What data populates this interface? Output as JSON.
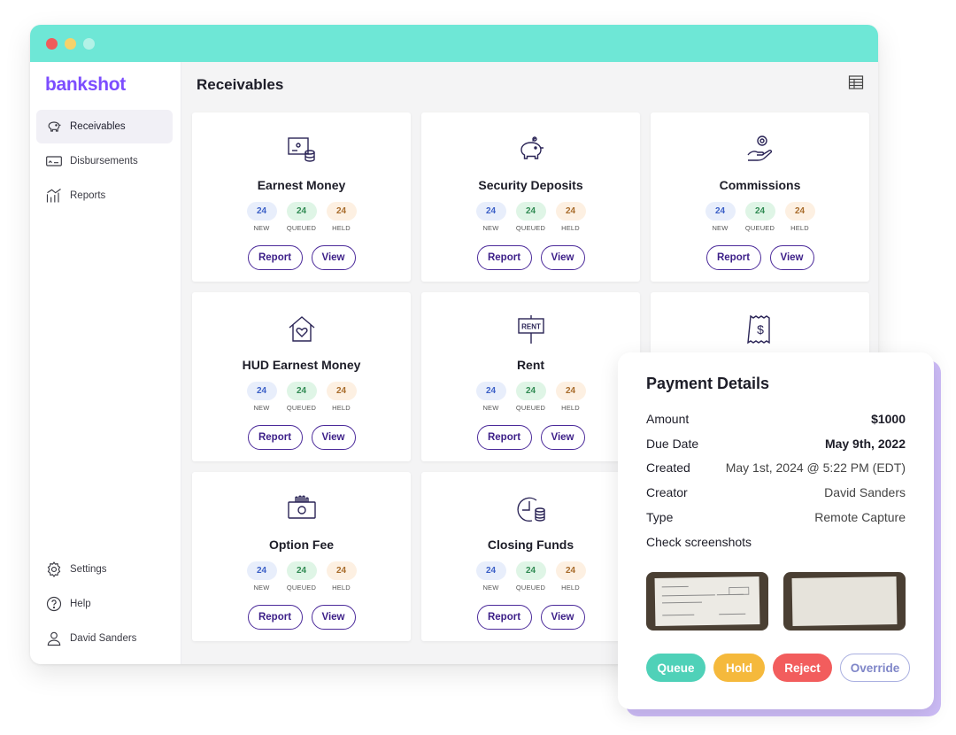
{
  "sidebar": {
    "logo": "bankshot",
    "nav": [
      {
        "label": "Receivables",
        "icon": "piggy-bank-icon",
        "active": true
      },
      {
        "label": "Disbursements",
        "icon": "check-card-icon"
      },
      {
        "label": "Reports",
        "icon": "chart-icon"
      }
    ],
    "bottom": [
      {
        "label": "Settings",
        "icon": "gear-icon"
      },
      {
        "label": "Help",
        "icon": "help-icon"
      },
      {
        "label": "David Sanders",
        "icon": "user-icon"
      }
    ]
  },
  "main": {
    "title": "Receivables",
    "cards": [
      {
        "title": "Earnest Money",
        "icon": "check-coins-icon",
        "new": "24",
        "queued": "24",
        "held": "24"
      },
      {
        "title": "Security Deposits",
        "icon": "piggy-bank-icon",
        "new": "24",
        "queued": "24",
        "held": "24"
      },
      {
        "title": "Commissions",
        "icon": "hand-coin-icon",
        "new": "24",
        "queued": "24",
        "held": "24"
      },
      {
        "title": "HUD Earnest Money",
        "icon": "house-heart-icon",
        "new": "24",
        "queued": "24",
        "held": "24"
      },
      {
        "title": "Rent",
        "icon": "rent-sign-icon",
        "new": "24",
        "queued": "24",
        "held": "24"
      },
      {
        "title": "",
        "icon": "receipt-dollar-icon"
      },
      {
        "title": "Option Fee",
        "icon": "money-hand-icon",
        "new": "24",
        "queued": "24",
        "held": "24"
      },
      {
        "title": "Closing Funds",
        "icon": "clock-coins-icon",
        "new": "24",
        "queued": "24",
        "held": "24"
      }
    ],
    "labels": {
      "new": "NEW",
      "queued": "QUEUED",
      "held": "HELD",
      "report": "Report",
      "view": "View",
      "rent_sign": "RENT",
      "dollar": "$"
    }
  },
  "payment_details": {
    "title": "Payment Details",
    "amount_label": "Amount",
    "amount": "$1000",
    "due_label": "Due Date",
    "due": "May 9th, 2022",
    "created_label": "Created",
    "created": "May 1st, 2024 @ 5:22 PM (EDT)",
    "creator_label": "Creator",
    "creator": "David Sanders",
    "type_label": "Type",
    "type": "Remote Capture",
    "screens_label": "Check screenshots",
    "actions": {
      "queue": "Queue",
      "hold": "Hold",
      "reject": "Reject",
      "override": "Override"
    }
  },
  "colors": {
    "accent": "#7c4dff",
    "titlebar": "#6ee7d6",
    "button_border": "#4b2a9a",
    "queue": "#4fd1b8",
    "hold": "#f5b93c",
    "reject": "#f25d5d",
    "panel_shadow": "#cdbcf7"
  }
}
